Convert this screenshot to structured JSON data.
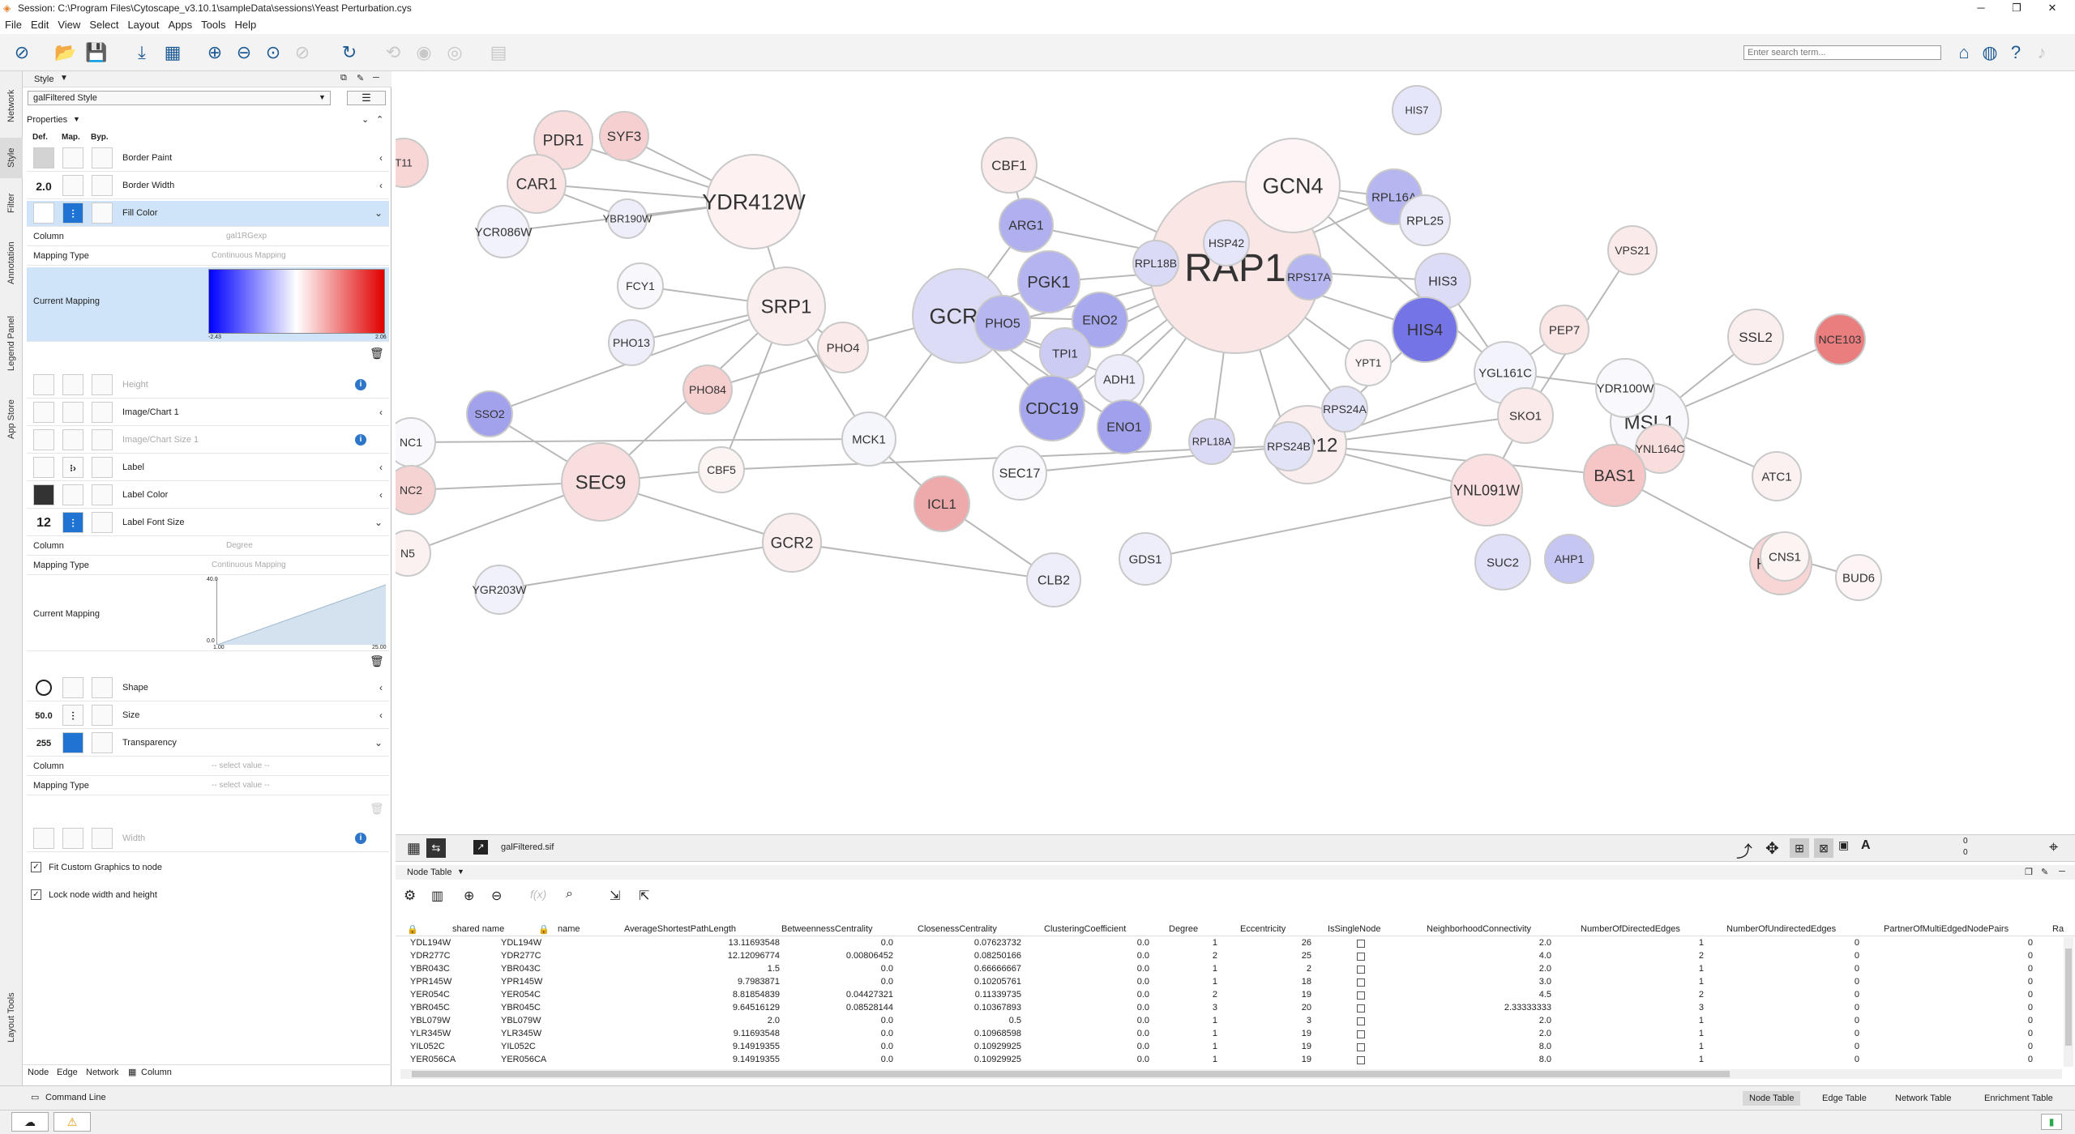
{
  "window": {
    "title": "Session: C:\\Program Files\\Cytoscape_v3.10.1\\sampleData\\sessions\\Yeast Perturbation.cys"
  },
  "menu": [
    "File",
    "Edit",
    "View",
    "Select",
    "Layout",
    "Apps",
    "Tools",
    "Help"
  ],
  "search": {
    "placeholder": "Enter search term..."
  },
  "vtabs": [
    "Network",
    "Style",
    "Filter",
    "Annotation",
    "Legend Panel",
    "App Store",
    "Layout Tools"
  ],
  "style_panel": {
    "header": "Style",
    "style_name": "galFiltered Style",
    "properties_label": "Properties",
    "col_def": "Def.",
    "col_map": "Map.",
    "col_byp": "Byp.",
    "props": {
      "border_paint": "Border Paint",
      "border_width": "Border Width",
      "border_width_val": "2.0",
      "fill_color": "Fill Color",
      "column_lbl": "Column",
      "mapping_type_lbl": "Mapping Type",
      "current_mapping_lbl": "Current Mapping",
      "fill_column": "gal1RGexp",
      "continuous": "Continuous Mapping",
      "grad_min": "-2.43",
      "grad_max": "2.06",
      "height": "Height",
      "image_chart": "Image/Chart 1",
      "image_chart_size": "Image/Chart Size 1",
      "label": "Label",
      "label_color": "Label Color",
      "label_font_size": "Label Font Size",
      "label_font_size_val": "12",
      "font_column": "Degree",
      "font_y_max": "40.0",
      "font_y_min": "0.0",
      "font_x_min": "1.00",
      "font_x_max": "25.00",
      "shape": "Shape",
      "size": "Size",
      "size_val": "50.0",
      "transparency": "Transparency",
      "transparency_val": "255",
      "select_value": "-- select value --",
      "width": "Width",
      "fit_custom": "Fit Custom Graphics to node",
      "lock_size": "Lock node width and height"
    },
    "tabs": [
      "Node",
      "Edge",
      "Network",
      "Column"
    ]
  },
  "colors": {
    "accent": "#1f73d2",
    "grad_low": "#0000ff",
    "grad_mid": "#ffffff",
    "grad_high": "#e00000"
  },
  "canvas": {
    "network_name": "galFiltered.sif",
    "num_a": "0",
    "num_b": "0",
    "nodes": [
      {
        "l": "RAP1",
        "c": "#fbe6e6"
      },
      {
        "l": "GCR1",
        "c": "#dcdcf7"
      },
      {
        "l": "GCN4",
        "c": "#fdf5f5"
      },
      {
        "l": "YDR412W",
        "c": "#fdf1f1"
      },
      {
        "l": "SRP1",
        "c": "#fbeeee"
      },
      {
        "l": "SEC9",
        "c": "#f8dede"
      },
      {
        "l": "PEP12",
        "c": "#fbeeee"
      },
      {
        "l": "MSL1",
        "c": "#f7f7fc"
      },
      {
        "l": "PDR1",
        "c": "#f9dddd"
      },
      {
        "l": "CAR1",
        "c": "#fae3e3"
      },
      {
        "l": "SYF3",
        "c": "#f6d0d0"
      },
      {
        "l": "CBF1",
        "c": "#fbeaea"
      },
      {
        "l": "RPL16A",
        "c": "#b6b6f0"
      },
      {
        "l": "RPL25",
        "c": "#ebebfa"
      },
      {
        "l": "YBR190W",
        "c": "#eeeefa"
      },
      {
        "l": "YCR086W",
        "c": "#f2f2fc"
      },
      {
        "l": "ARG1",
        "c": "#b0b0ef"
      },
      {
        "l": "HSP42",
        "c": "#e6e6fa"
      },
      {
        "l": "RPL18B",
        "c": "#dadaf6"
      },
      {
        "l": "RPS17A",
        "c": "#b6b6f0"
      },
      {
        "l": "HIS3",
        "c": "#dcdcf7"
      },
      {
        "l": "VPS21",
        "c": "#fbeaea"
      },
      {
        "l": "PGK1",
        "c": "#b4b4f0"
      },
      {
        "l": "FCY1",
        "c": "#f7f7fc"
      },
      {
        "l": "HIS4",
        "c": "#7474e6"
      },
      {
        "l": "PEP7",
        "c": "#fbe6e6"
      },
      {
        "l": "PHO5",
        "c": "#b6b6f0"
      },
      {
        "l": "ENO2",
        "c": "#a8a8ee"
      },
      {
        "l": "NCE103",
        "c": "#ea7d7d"
      },
      {
        "l": "SSL2",
        "c": "#fbeeee"
      },
      {
        "l": "PHO13",
        "c": "#eeeefa"
      },
      {
        "l": "PHO4",
        "c": "#fbeaea"
      },
      {
        "l": "TPI1",
        "c": "#cbcbf4"
      },
      {
        "l": "YPT1",
        "c": "#fdf5f5"
      },
      {
        "l": "YGL161C",
        "c": "#f3f3fc"
      },
      {
        "l": "YDR100W",
        "c": "#f9f9fd"
      },
      {
        "l": "ADH1",
        "c": "#ececfa"
      },
      {
        "l": "PHO84",
        "c": "#f6cfcf"
      },
      {
        "l": "SSO2",
        "c": "#a2a2ec"
      },
      {
        "l": "CDC19",
        "c": "#a6a6ee"
      },
      {
        "l": "RPS24A",
        "c": "#e3e3f8"
      },
      {
        "l": "SKO1",
        "c": "#fbeaea"
      },
      {
        "l": "ENO1",
        "c": "#a0a0ec"
      },
      {
        "l": "MCK1",
        "c": "#f5f5fc"
      },
      {
        "l": "RPL18A",
        "c": "#dadaf6"
      },
      {
        "l": "RPS24B",
        "c": "#e3e3f8"
      },
      {
        "l": "YNL164C",
        "c": "#f9dede"
      },
      {
        "l": "NC1",
        "c": "#f9f9fd"
      },
      {
        "l": "BAS1",
        "c": "#f6c5c5"
      },
      {
        "l": "ATC1",
        "c": "#fbf1f1"
      },
      {
        "l": "CBF5",
        "c": "#fcf3f3"
      },
      {
        "l": "SEC17",
        "c": "#f9f9fd"
      },
      {
        "l": "YNL091W",
        "c": "#fae0e0"
      },
      {
        "l": "NC2",
        "c": "#f6d3d3"
      },
      {
        "l": "ICL1",
        "c": "#eeaaaa"
      },
      {
        "l": "N5",
        "c": "#fbf1f1"
      },
      {
        "l": "GCR2",
        "c": "#fbeeee"
      },
      {
        "l": "GDS1",
        "c": "#eeeefa"
      },
      {
        "l": "SUC2",
        "c": "#e0e0f8"
      },
      {
        "l": "AHP1",
        "c": "#c6c6f3"
      },
      {
        "l": "HSP82",
        "c": "#f8d6d6"
      },
      {
        "l": "CNS1",
        "c": "#fcf3f3"
      },
      {
        "l": "BUD6",
        "c": "#fdf5f5"
      },
      {
        "l": "YGR203W",
        "c": "#f1f1fb"
      },
      {
        "l": "CLB2",
        "c": "#eeeefa"
      },
      {
        "l": "T11",
        "c": "#f8d6d6"
      },
      {
        "l": "HIS7",
        "c": "#e6e6fa"
      }
    ]
  },
  "table": {
    "title": "Node Table",
    "columns": [
      "shared name",
      "name",
      "AverageShortestPathLength",
      "BetweennessCentrality",
      "ClosenessCentrality",
      "ClusteringCoefficient",
      "Degree",
      "Eccentricity",
      "IsSingleNode",
      "NeighborhoodConnectivity",
      "NumberOfDirectedEdges",
      "NumberOfUndirectedEdges",
      "PartnerOfMultiEdgedNodePairs",
      "Ra"
    ],
    "rows": [
      [
        "YDL194W",
        "YDL194W",
        "13.11693548",
        "0.0",
        "0.07623732",
        "0.0",
        "1",
        "26",
        "2.0",
        "1",
        "0",
        "0"
      ],
      [
        "YDR277C",
        "YDR277C",
        "12.12096774",
        "0.00806452",
        "0.08250166",
        "0.0",
        "2",
        "25",
        "4.0",
        "2",
        "0",
        "0"
      ],
      [
        "YBR043C",
        "YBR043C",
        "1.5",
        "0.0",
        "0.66666667",
        "0.0",
        "1",
        "2",
        "2.0",
        "1",
        "0",
        "0"
      ],
      [
        "YPR145W",
        "YPR145W",
        "9.7983871",
        "0.0",
        "0.10205761",
        "0.0",
        "1",
        "18",
        "3.0",
        "1",
        "0",
        "0"
      ],
      [
        "YER054C",
        "YER054C",
        "8.81854839",
        "0.04427321",
        "0.11339735",
        "0.0",
        "2",
        "19",
        "4.5",
        "2",
        "0",
        "0"
      ],
      [
        "YBR045C",
        "YBR045C",
        "9.64516129",
        "0.08528144",
        "0.10367893",
        "0.0",
        "3",
        "20",
        "2.33333333",
        "3",
        "0",
        "0"
      ],
      [
        "YBL079W",
        "YBL079W",
        "2.0",
        "0.0",
        "0.5",
        "0.0",
        "1",
        "3",
        "2.0",
        "1",
        "0",
        "0"
      ],
      [
        "YLR345W",
        "YLR345W",
        "9.11693548",
        "0.0",
        "0.10968598",
        "0.0",
        "1",
        "19",
        "2.0",
        "1",
        "0",
        "0"
      ],
      [
        "YIL052C",
        "YIL052C",
        "9.14919355",
        "0.0",
        "0.10929925",
        "0.0",
        "1",
        "19",
        "8.0",
        "1",
        "0",
        "0"
      ],
      [
        "YER056CA",
        "YER056CA",
        "9.14919355",
        "0.0",
        "0.10929925",
        "0.0",
        "1",
        "19",
        "8.0",
        "1",
        "0",
        "0"
      ]
    ]
  },
  "bottom": {
    "command_line": "Command Line",
    "tabs": [
      "Node Table",
      "Edge Table",
      "Network Table",
      "Enrichment Table"
    ]
  }
}
